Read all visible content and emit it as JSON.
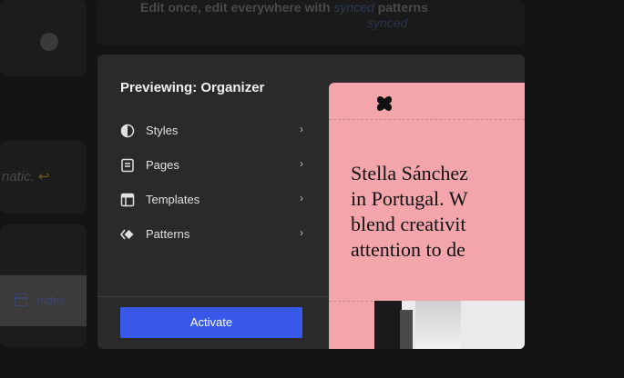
{
  "background": {
    "headline_prefix": "Edit once, edit everywhere with",
    "headline_synced": "synced",
    "headline_suffix": "patterns",
    "synced_repeat": "synced",
    "matic_text": "natic.",
    "matic_arrow": "↩",
    "index_label": "Index"
  },
  "modal": {
    "title": "Previewing: Organizer",
    "nav": [
      {
        "label": "Styles",
        "icon": "contrast-icon"
      },
      {
        "label": "Pages",
        "icon": "page-icon"
      },
      {
        "label": "Templates",
        "icon": "layout-icon"
      },
      {
        "label": "Patterns",
        "icon": "symbol-icon"
      }
    ],
    "chevron": "›",
    "activate_label": "Activate"
  },
  "preview": {
    "lines": [
      "Stella Sánchez",
      "in Portugal. W",
      "blend creativit",
      "attention to de"
    ],
    "background_color": "#f2a5ab"
  },
  "colors": {
    "accent": "#3858e9",
    "modal_bg": "#2a2a2a",
    "page_bg": "#141414"
  }
}
